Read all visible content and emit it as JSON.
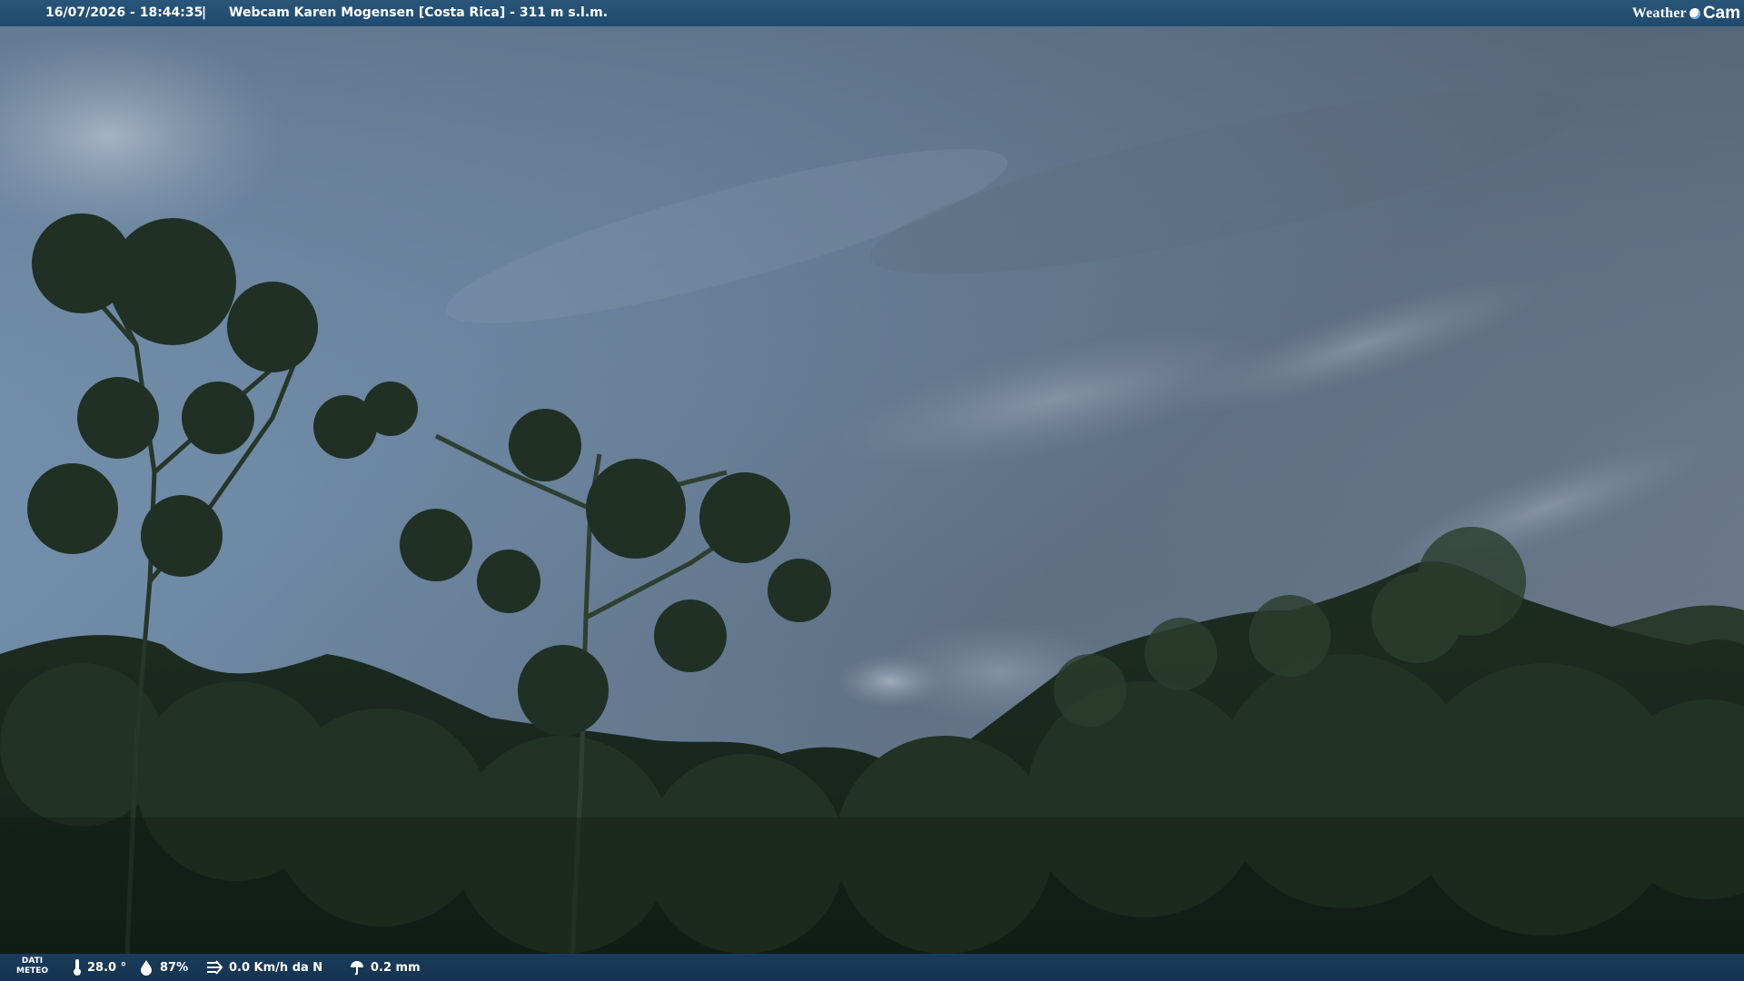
{
  "header": {
    "timestamp": "16/07/2026 - 18:44:35",
    "separator": "|",
    "title": "Webcam Karen Mogensen [Costa Rica] - 311 m s.l.m.",
    "logo_left": "Weather",
    "logo_right": "Cam"
  },
  "footer": {
    "dati_label_line1": "DATI",
    "dati_label_line2": "METEO",
    "temperature": "28.0 °",
    "humidity": "87%",
    "wind": "0.0 Km/h da N",
    "rain": "0.2 mm"
  },
  "icons": [
    "thermometer-icon",
    "humidity-icon",
    "wind-icon",
    "rain-icon"
  ],
  "colors": {
    "top_bar": "#1f4a6e",
    "bottom_bar": "#153350",
    "sky_top": "#6f88a3",
    "foliage": "#1b2a1d"
  }
}
